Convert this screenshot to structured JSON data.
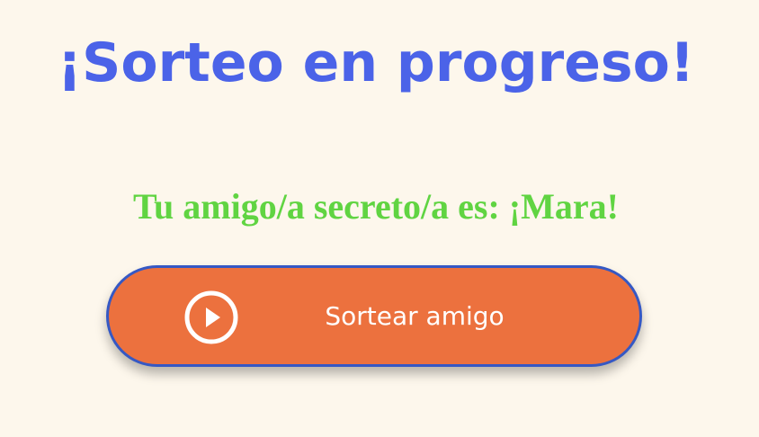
{
  "title": "¡Sorteo en progreso!",
  "result_text": "Tu amigo/a secreto/a es: ¡Mara!",
  "draw_button": {
    "label": "Sortear amigo",
    "icon": "play-circle-icon"
  },
  "colors": {
    "background": "#fdf7ec",
    "title": "#4b63e8",
    "result": "#60d442",
    "button_fill": "#ec713e",
    "button_border": "#3558c4"
  }
}
